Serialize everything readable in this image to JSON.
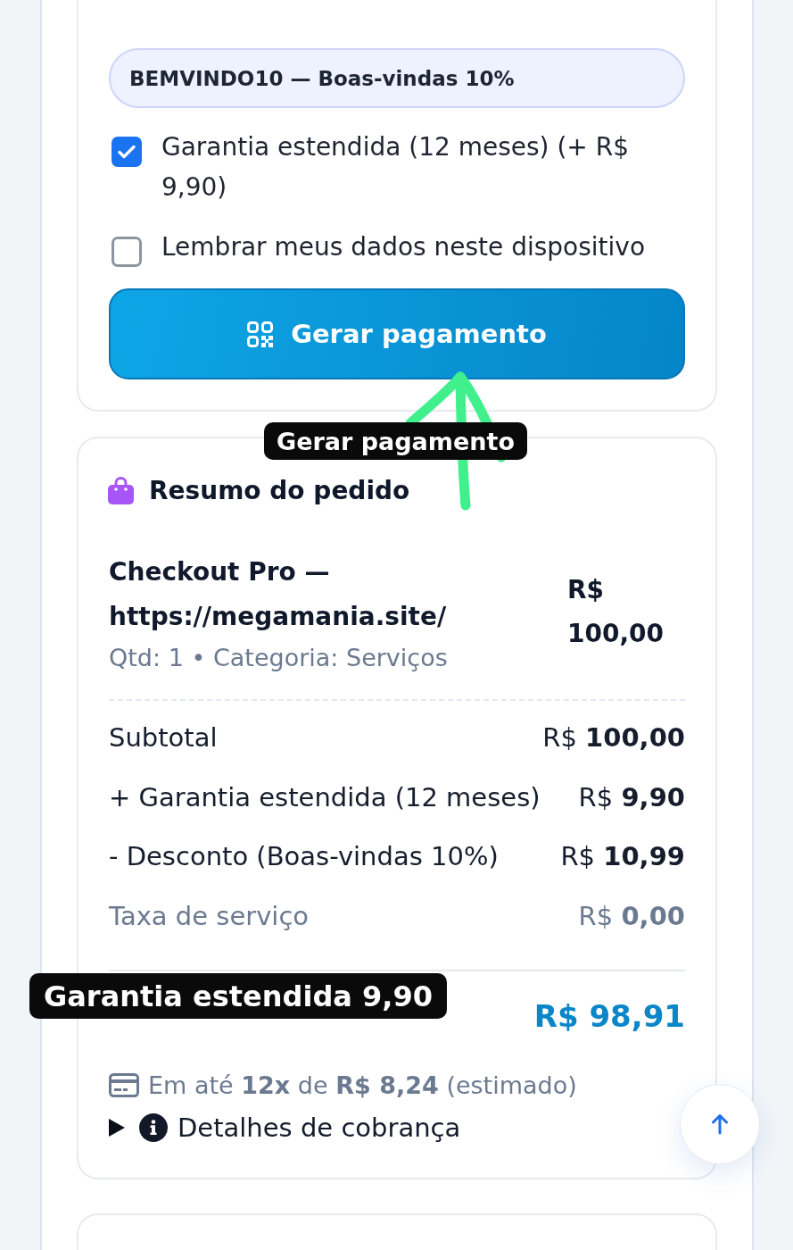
{
  "payment": {
    "coupon_field": {
      "value": "BEMVINDO10 — Boas-vindas 10%"
    },
    "options": [
      {
        "label": "Garantia estendida (12 meses) (+ R$ 9,90)",
        "checked": true
      },
      {
        "label": "Lembrar meus dados neste dispositivo",
        "checked": false
      }
    ],
    "submit_button": {
      "label": "Gerar pagamento"
    }
  },
  "order_summary": {
    "title": "Resumo do pedido",
    "item": {
      "name": "Checkout Pro — https://megamania.site/",
      "meta": "Qtd: 1 • Categoria: Serviços",
      "price": "R$ 100,00"
    },
    "lines": [
      {
        "label": "Subtotal",
        "amount": "R$ **100,00**",
        "muted": false
      },
      {
        "label": "+ Garantia estendida (12 meses)",
        "amount": "R$ **9,90**",
        "muted": false
      },
      {
        "label": "- Desconto (Boas-vindas 10%)",
        "amount": "R$ **10,99**",
        "muted": false
      },
      {
        "label": "Taxa de serviço",
        "amount": "R$ **0,00**",
        "muted": true
      }
    ],
    "total": {
      "amount": "R$ 98,91"
    },
    "installments": "Em até **12x** de **R$ 8,24** (estimado)",
    "billing_details": {
      "label": "Detalhes de cobrança",
      "expanded": false
    }
  },
  "annotations": [
    {
      "text": "Gerar pagamento"
    },
    {
      "text": "Garantia estendida 9,90"
    }
  ]
}
